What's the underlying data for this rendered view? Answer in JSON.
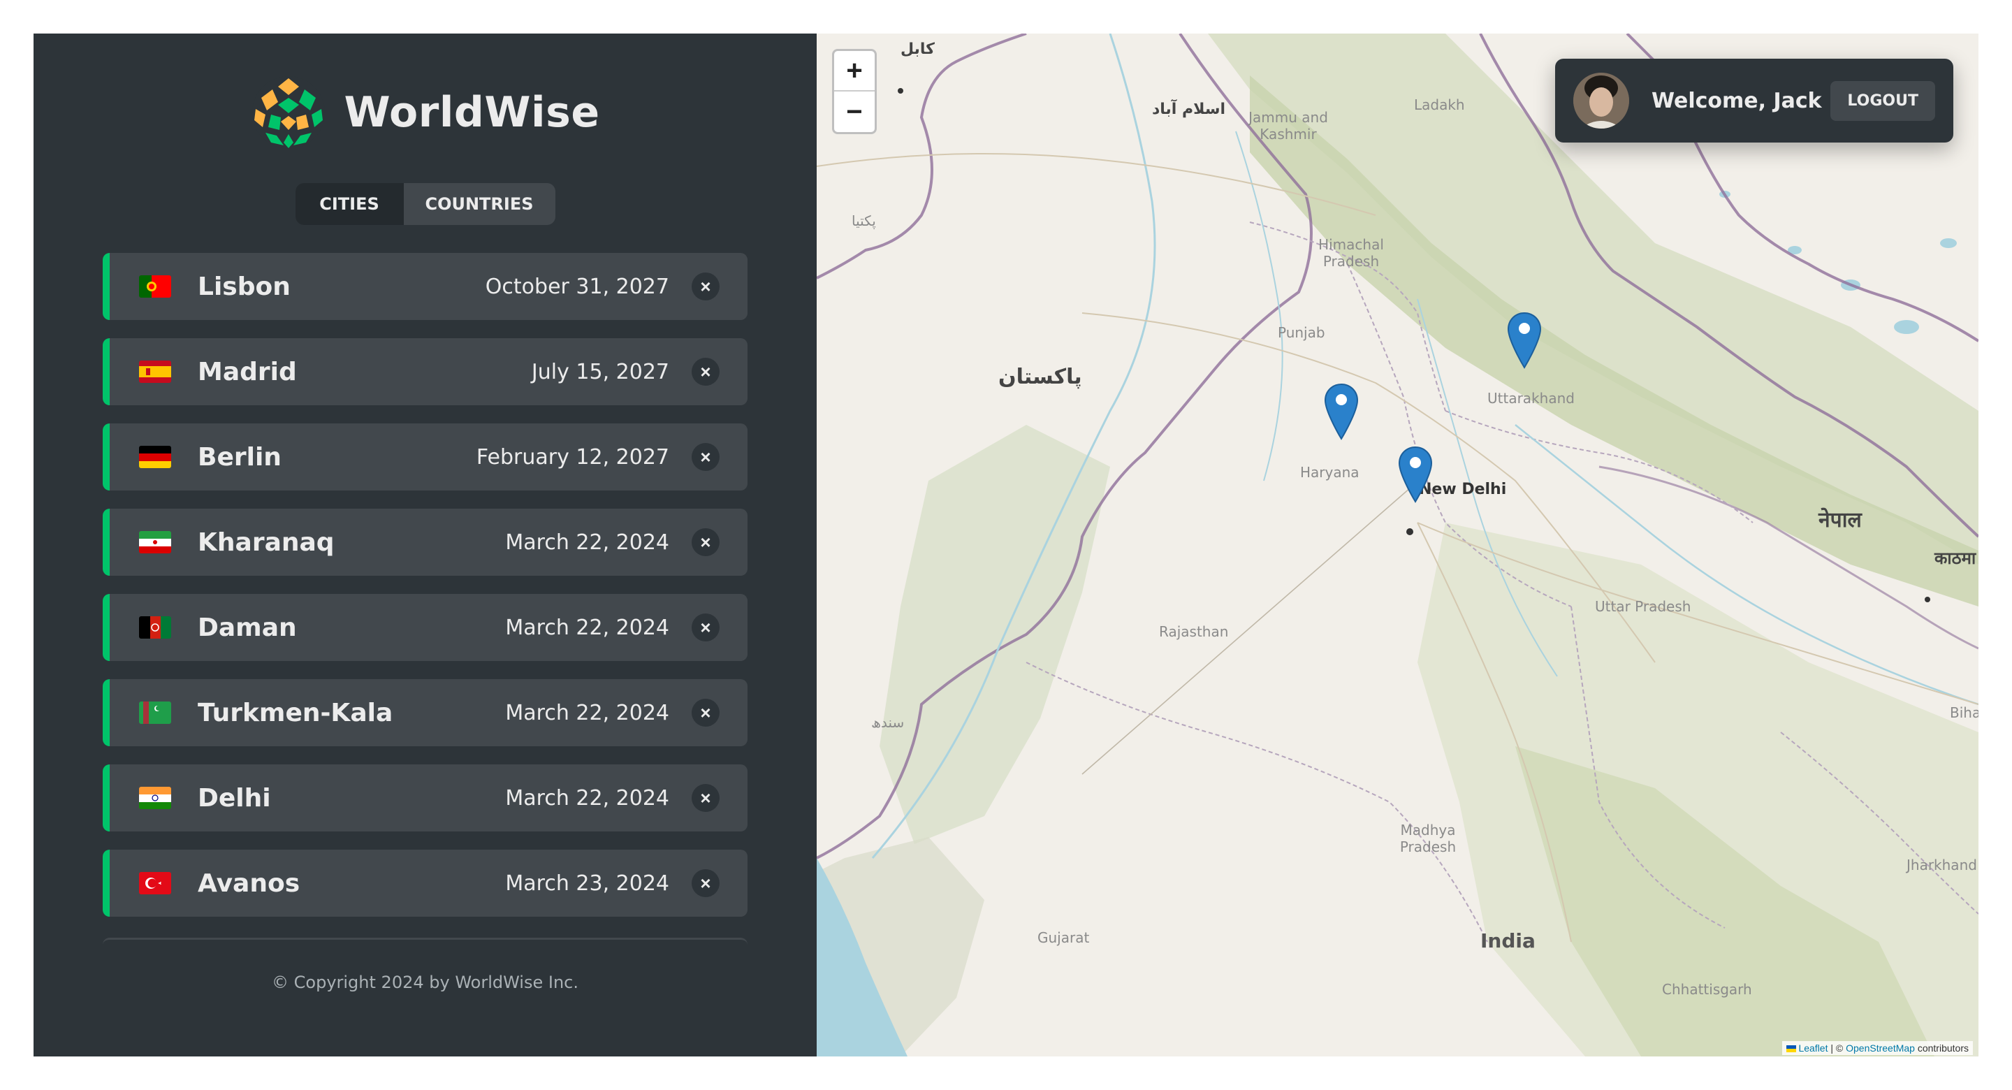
{
  "app": {
    "name": "WorldWise"
  },
  "tabs": [
    {
      "label": "Cities",
      "active": true
    },
    {
      "label": "Countries",
      "active": false
    }
  ],
  "cities": [
    {
      "name": "Lisbon",
      "date": "October 31, 2027",
      "flag": "portugal-flag"
    },
    {
      "name": "Madrid",
      "date": "July 15, 2027",
      "flag": "spain-flag"
    },
    {
      "name": "Berlin",
      "date": "February 12, 2027",
      "flag": "germany-flag"
    },
    {
      "name": "Kharanaq",
      "date": "March 22, 2024",
      "flag": "iran-flag"
    },
    {
      "name": "Daman",
      "date": "March 22, 2024",
      "flag": "afghanistan-flag"
    },
    {
      "name": "Turkmen-Kala",
      "date": "March 22, 2024",
      "flag": "turkmenistan-flag"
    },
    {
      "name": "Delhi",
      "date": "March 22, 2024",
      "flag": "india-flag"
    },
    {
      "name": "Avanos",
      "date": "March 23, 2024",
      "flag": "turkey-flag"
    }
  ],
  "delete_symbol": "×",
  "footer": "© Copyright 2024 by WorldWise Inc.",
  "map": {
    "zoom_in": "+",
    "zoom_out": "−",
    "attribution": {
      "leaflet": "Leaflet",
      "separator": " | © ",
      "osm": "OpenStreetMap",
      "suffix": " contributors"
    },
    "labels": {
      "ladakh": "Ladakh",
      "jammu": "Jammu and Kashmir",
      "himachal": "Himachal Pradesh",
      "punjab": "Punjab",
      "haryana": "Haryana",
      "uttarakhand": "Uttarakhand",
      "new_delhi": "New Delhi",
      "rajasthan": "Rajasthan",
      "uttar_pradesh": "Uttar Pradesh",
      "gujarat": "Gujarat",
      "madhya": "Madhya Pradesh",
      "india": "India",
      "jharkhand": "Jharkhand",
      "chhattisgarh": "Chhattisgarh",
      "bihar": "Bihar",
      "pakistan": "پاکستان",
      "islamabad": "اسلام آباد",
      "kabul": "کابل",
      "nepal": "नेपाल",
      "kathmandu": "काठमा",
      "sindh": "سندھ",
      "pakhtia": "پکتیا"
    }
  },
  "user": {
    "welcome": "Welcome, Jack",
    "logout": "Logout"
  },
  "colors": {
    "sidebar": "#2d3439",
    "row": "#42484d",
    "accent": "#00c46a",
    "marker": "#2a81cb"
  }
}
